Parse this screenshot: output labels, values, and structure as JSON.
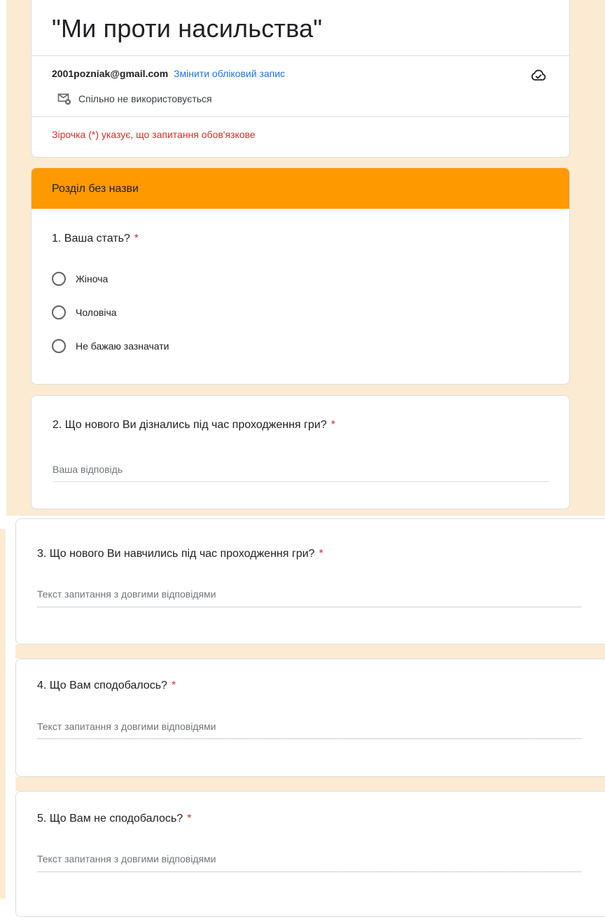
{
  "form": {
    "title": "\"Ми проти насильства\"",
    "account_email": "2001pozniak@gmail.com",
    "switch_account": "Змінити обліковий запис",
    "not_shared": "Спільно не використовується",
    "required_note": "Зірочка (*) указує, що запитання обов'язкове"
  },
  "section": {
    "title": "Розділ без назви"
  },
  "questions": [
    {
      "label": "1. Ваша стать?",
      "required": "*",
      "options": [
        "Жіноча",
        "Чоловіча",
        "Не бажаю зазначати"
      ]
    },
    {
      "label": "2. Що нового Ви дізнались під час проходження гри?",
      "required": "*",
      "placeholder": "Ваша відповідь"
    },
    {
      "label": "3. Що нового Ви навчились під час проходження гри?",
      "required": "*",
      "placeholder": "Текст запитання з довгими відповідями"
    },
    {
      "label": "4. Що Вам сподобалось?",
      "required": "*",
      "placeholder": "Текст запитання з довгими відповідями"
    },
    {
      "label": "5. Що Вам не сподобалось?",
      "required": "*",
      "placeholder": "Текст запитання з довгими відповідями"
    }
  ],
  "colors": {
    "accent": "#ff9900",
    "background": "#fcebd3",
    "link": "#1a73e8",
    "required": "#d93025"
  },
  "icons": [
    "cloud-saved-icon",
    "mail-not-shared-icon"
  ]
}
